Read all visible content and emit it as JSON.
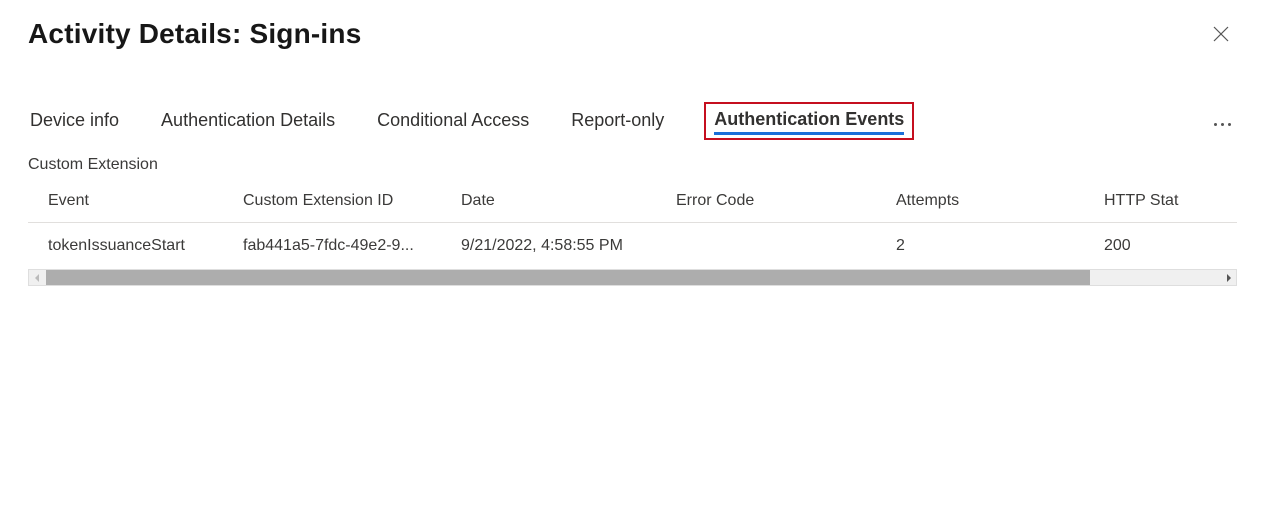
{
  "header": {
    "title": "Activity Details: Sign-ins"
  },
  "tabs": {
    "items": [
      {
        "label": "Device info"
      },
      {
        "label": "Authentication Details"
      },
      {
        "label": "Conditional Access"
      },
      {
        "label": "Report-only"
      },
      {
        "label": "Authentication Events"
      }
    ],
    "activeIndex": 4
  },
  "section": {
    "label": "Custom Extension"
  },
  "table": {
    "columns": {
      "event": "Event",
      "extension_id": "Custom Extension ID",
      "date": "Date",
      "error_code": "Error Code",
      "attempts": "Attempts",
      "http_status": "HTTP Stat"
    },
    "rows": [
      {
        "event": "tokenIssuanceStart",
        "extension_id": "fab441a5-7fdc-49e2-9...",
        "date": "9/21/2022, 4:58:55 PM",
        "error_code": "",
        "attempts": "2",
        "http_status": "200"
      }
    ]
  }
}
